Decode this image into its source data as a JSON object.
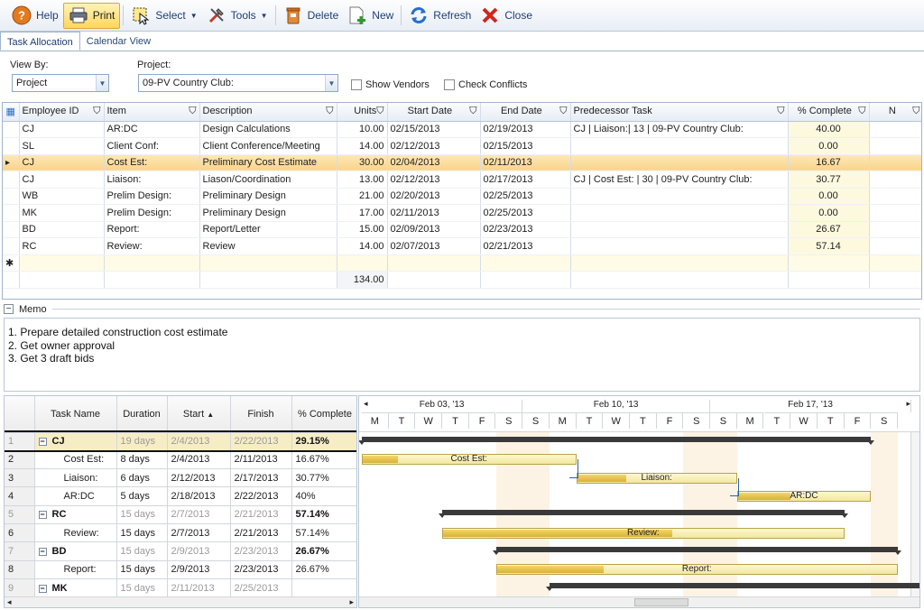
{
  "toolbar": {
    "help": "Help",
    "print": "Print",
    "select": "Select",
    "tools": "Tools",
    "delete": "Delete",
    "new": "New",
    "refresh": "Refresh",
    "close": "Close"
  },
  "tabs": [
    "Task Allocation",
    "Calendar View"
  ],
  "filters": {
    "view_by_label": "View By:",
    "view_by_value": "Project",
    "project_label": "Project:",
    "project_value": "09-PV Country Club:",
    "show_vendors": "Show Vendors",
    "check_conflicts": "Check Conflicts"
  },
  "grid": {
    "headers": [
      "Employee ID",
      "Item",
      "Description",
      "Units",
      "Start Date",
      "End Date",
      "Predecessor Task",
      "% Complete",
      "N"
    ],
    "rows": [
      [
        "CJ",
        "AR:DC",
        "Design Calculations",
        "10.00",
        "02/15/2013",
        "02/19/2013",
        "CJ | Liaison:|  13 | 09-PV Country Club:",
        "40.00",
        ""
      ],
      [
        "SL",
        "Client Conf:",
        "Client Conference/Meeting",
        "14.00",
        "02/12/2013",
        "02/15/2013",
        "",
        "0.00",
        ""
      ],
      [
        "CJ",
        "Cost Est:",
        "Preliminary Cost Estimate",
        "30.00",
        "02/04/2013",
        "02/11/2013",
        "",
        "16.67",
        ""
      ],
      [
        "CJ",
        "Liaison:",
        "Liason/Coordination",
        "13.00",
        "02/12/2013",
        "02/17/2013",
        "CJ | Cost Est: |  30 | 09-PV Country Club:",
        "30.77",
        ""
      ],
      [
        "WB",
        "Prelim Design:",
        "Preliminary Design",
        "21.00",
        "02/20/2013",
        "02/25/2013",
        "",
        "0.00",
        ""
      ],
      [
        "MK",
        "Prelim Design:",
        "Preliminary Design",
        "17.00",
        "02/11/2013",
        "02/25/2013",
        "",
        "0.00",
        ""
      ],
      [
        "BD",
        "Report:",
        "Report/Letter",
        "15.00",
        "02/09/2013",
        "02/23/2013",
        "",
        "26.67",
        ""
      ],
      [
        "RC",
        "Review:",
        "Review",
        "14.00",
        "02/07/2013",
        "02/21/2013",
        "",
        "57.14",
        ""
      ]
    ],
    "selected_row": 2,
    "total_units": "134.00"
  },
  "memo": {
    "title": "Memo",
    "lines": [
      "1. Prepare detailed construction cost estimate",
      "2. Get owner approval",
      "3. Get 3 draft bids"
    ]
  },
  "project_grid": {
    "headers": [
      "Task Name",
      "Duration",
      "Start",
      "Finish",
      "% Complete"
    ],
    "rows": [
      {
        "n": "1",
        "group": true,
        "name": "CJ",
        "duration": "19 days",
        "start": "2/4/2013",
        "finish": "2/22/2013",
        "pct": "29.15%"
      },
      {
        "n": "2",
        "group": false,
        "name": "Cost Est:",
        "duration": "8 days",
        "start": "2/4/2013",
        "finish": "2/11/2013",
        "pct": "16.67%"
      },
      {
        "n": "3",
        "group": false,
        "name": "Liaison:",
        "duration": "6 days",
        "start": "2/12/2013",
        "finish": "2/17/2013",
        "pct": "30.77%"
      },
      {
        "n": "4",
        "group": false,
        "name": "AR:DC",
        "duration": "5 days",
        "start": "2/18/2013",
        "finish": "2/22/2013",
        "pct": "40%"
      },
      {
        "n": "5",
        "group": true,
        "name": "RC",
        "duration": "15 days",
        "start": "2/7/2013",
        "finish": "2/21/2013",
        "pct": "57.14%"
      },
      {
        "n": "6",
        "group": false,
        "name": "Review:",
        "duration": "15 days",
        "start": "2/7/2013",
        "finish": "2/21/2013",
        "pct": "57.14%"
      },
      {
        "n": "7",
        "group": true,
        "name": "BD",
        "duration": "15 days",
        "start": "2/9/2013",
        "finish": "2/23/2013",
        "pct": "26.67%"
      },
      {
        "n": "8",
        "group": false,
        "name": "Report:",
        "duration": "15 days",
        "start": "2/9/2013",
        "finish": "2/23/2013",
        "pct": "26.67%"
      },
      {
        "n": "9",
        "group": true,
        "name": "MK",
        "duration": "15 days",
        "start": "2/11/2013",
        "finish": "2/25/2013",
        "pct": ""
      }
    ]
  },
  "gantt": {
    "weeks": [
      "Feb 03, '13",
      "Feb 10, '13",
      "Feb 17, '13"
    ],
    "days": [
      "M",
      "T",
      "W",
      "T",
      "F",
      "S",
      "S",
      "M",
      "T",
      "W",
      "T",
      "F",
      "S",
      "S",
      "M",
      "T",
      "W",
      "T",
      "F",
      "S"
    ],
    "bar_labels": {
      "cost": "Cost Est:",
      "liaison": "Liaison:",
      "ardc": "AR:DC",
      "review": "Review:",
      "report": "Report:"
    }
  }
}
